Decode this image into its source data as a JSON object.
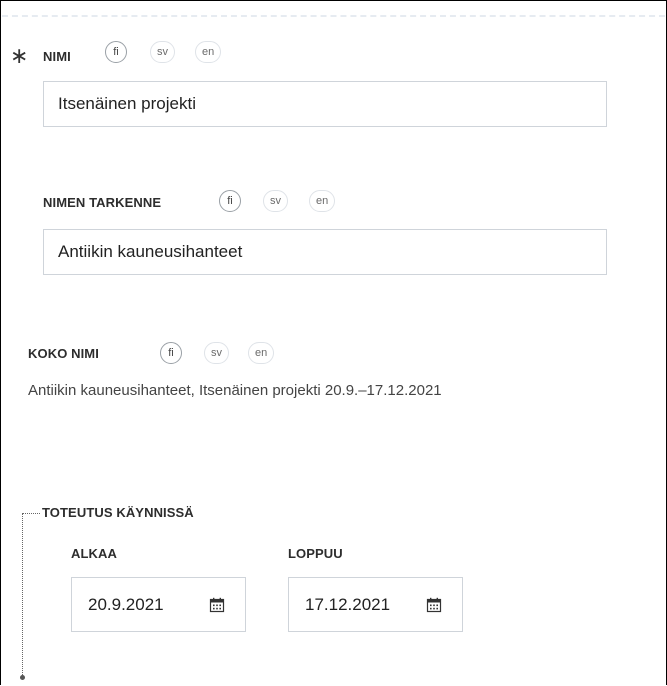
{
  "name_field": {
    "label": "NIMI",
    "required_marker": "∗",
    "value": "Itsenäinen projekti",
    "languages": [
      "fi",
      "sv",
      "en"
    ]
  },
  "name_specifier_field": {
    "label": "NIMEN TARKENNE",
    "value": "Antiikin kauneusihanteet",
    "languages": [
      "fi",
      "sv",
      "en"
    ]
  },
  "full_name_field": {
    "label": "KOKO NIMI",
    "value": "Antiikin kauneusihanteet, Itsenäinen projekti 20.9.–17.12.2021",
    "languages": [
      "fi",
      "sv",
      "en"
    ]
  },
  "implementation_period": {
    "label": "TOTEUTUS KÄYNNISSÄ",
    "start_label": "ALKAA",
    "start_value": "20.9.2021",
    "end_label": "LOPPUU",
    "end_value": "17.12.2021"
  },
  "icons": {
    "required": "asterisk-icon",
    "calendar": "calendar-icon"
  },
  "colors": {
    "border": "#cfd4da",
    "pill_border": "#dfe3e8",
    "text": "#222222"
  }
}
